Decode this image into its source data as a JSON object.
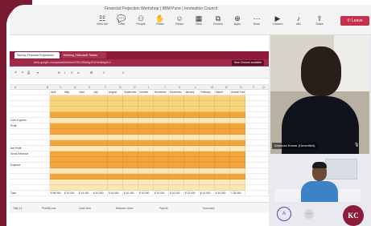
{
  "meeting": {
    "title": "Financial Projection Workshop | IIBM Pune | Innovation Council"
  },
  "toolbar": {
    "buttons": [
      {
        "label": "View tab",
        "icon": "chat-icon"
      },
      {
        "label": "Chat",
        "icon": "chat-bubble-icon"
      },
      {
        "label": "People",
        "icon": "people-icon"
      },
      {
        "label": "Raise",
        "icon": "raise-hand-icon"
      },
      {
        "label": "React",
        "icon": "react-icon"
      },
      {
        "label": "View",
        "icon": "view-icon"
      },
      {
        "label": "Rooms",
        "icon": "rooms-icon"
      },
      {
        "label": "Apps",
        "icon": "apps-icon"
      },
      {
        "label": "More",
        "icon": "more-icon"
      },
      {
        "label": "Camera",
        "icon": "camera-icon"
      },
      {
        "label": "Mic",
        "icon": "mic-icon"
      },
      {
        "label": "Share",
        "icon": "share-icon"
      }
    ],
    "leave_label": "Leave"
  },
  "browser": {
    "tabs": [
      "Startup Financial Projections",
      "Meeting | Microsoft Teams"
    ],
    "url": "docs.google.com/spreadsheets/d/1RS-BSIa0ig4RcG/edit#gid=0",
    "badge": "Now Chrome available"
  },
  "sheet": {
    "column_heads": [
      "A",
      "B",
      "C",
      "D",
      "E",
      "F",
      "G",
      "H",
      "I",
      "J",
      "K",
      "L",
      "M",
      "N",
      "O",
      "P",
      "Q"
    ],
    "header_labels": [
      "April",
      "May",
      "June",
      "July",
      "August",
      "September",
      "October",
      "November",
      "December",
      "January",
      "February",
      "March",
      "Annual Total"
    ],
    "row_labels": [
      "",
      "",
      "",
      "",
      "",
      "Cost of goods",
      "Profit",
      "",
      "",
      "",
      "Net Profit",
      "Gross Revenue",
      "",
      "Expense",
      "",
      "",
      "",
      "",
      "Total"
    ],
    "total_row_values": [
      "$ 96,000",
      "$ 10,000",
      "$ 14,000",
      "$ 10,000",
      "$ 10,000",
      "$ 10,000",
      "$ 10,000",
      "$ 10,000",
      "$ 10,000",
      "$ 12,000",
      "$ 14,000",
      "$ 10,000",
      "1,28,000"
    ],
    "sheet_tabs": [
      "Tally 14",
      "Profit&Loss",
      "Cash flow",
      "Balance sheet",
      "Payroll",
      "Summary"
    ]
  },
  "participants": {
    "main_name": "Anweran Kumar (Unverified)",
    "avatar_letter": "A",
    "more_label": "…",
    "logo_text": "KC"
  },
  "colors": {
    "accent": "#8c1c3a",
    "leave": "#c4314b",
    "cell_orange": "#f2a53a",
    "cell_yellow": "#f7d37a",
    "cell_light": "#fbe7b6"
  }
}
